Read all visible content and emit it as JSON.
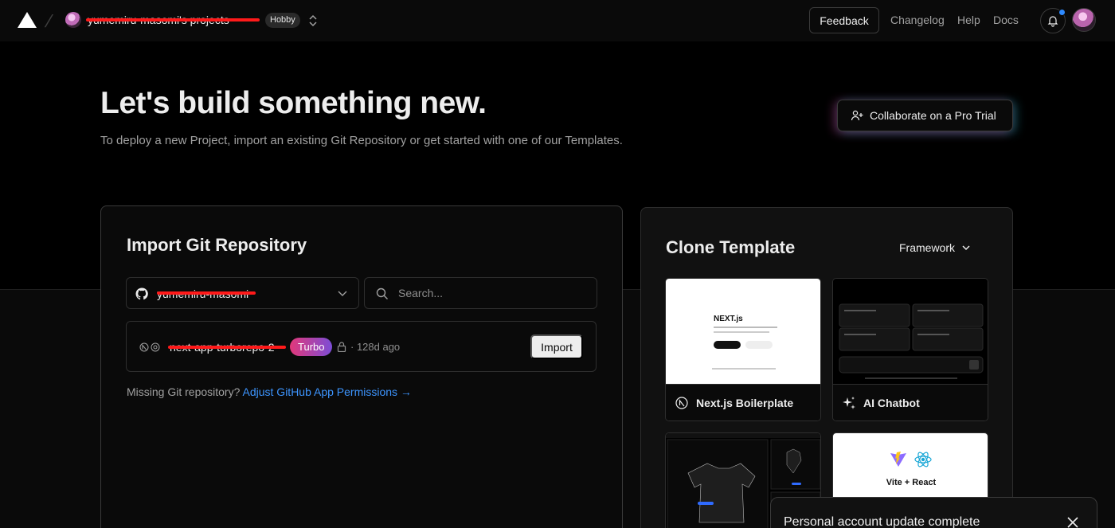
{
  "header": {
    "team_name": "yumemiru-masomi's projects",
    "plan_badge": "Hobby",
    "feedback_label": "Feedback",
    "links": [
      "Changelog",
      "Help",
      "Docs"
    ]
  },
  "hero": {
    "title": "Let's build something new.",
    "subtitle": "To deploy a new Project, import an existing Git Repository or get started with one of our Templates.",
    "pro_trial_label": "Collaborate on a Pro Trial"
  },
  "import": {
    "title": "Import Git Repository",
    "scope_value": "yumemiru-masomi",
    "search_placeholder": "Search...",
    "repos": [
      {
        "name": "next-app-turborepo-2",
        "badge": "Turbo",
        "age": "· 128d ago",
        "action": "Import"
      }
    ],
    "missing_text": "Missing Git repository? ",
    "missing_link": "Adjust GitHub App Permissions →"
  },
  "clone": {
    "title": "Clone Template",
    "filter_label": "Framework",
    "templates": [
      {
        "name": "Next.js Boilerplate"
      },
      {
        "name": "AI Chatbot"
      },
      {
        "name": ""
      },
      {
        "name": "Vite + React"
      }
    ]
  },
  "toast": {
    "message": "Personal account update complete"
  },
  "colors": {
    "accent_blue": "#3d95ff",
    "notification": "#2f8bff",
    "redaction": "#ff1a1a"
  }
}
